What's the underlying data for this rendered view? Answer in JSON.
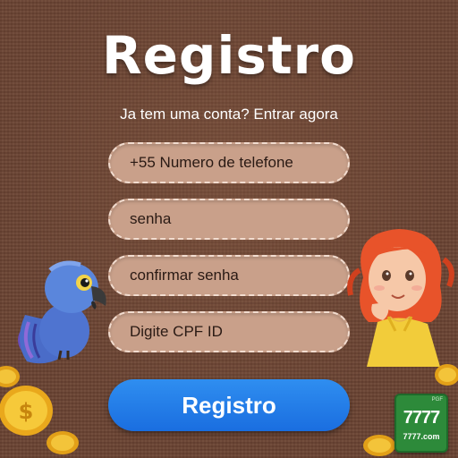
{
  "header": {
    "title": "Registro",
    "subtitle": "Ja tem uma conta? Entrar agora"
  },
  "form": {
    "phone_placeholder": "+55 Numero de telefone",
    "password_placeholder": "senha",
    "confirm_placeholder": "confirmar senha",
    "cpf_placeholder": "Digite CPF ID",
    "submit_label": "Registro"
  },
  "logo": {
    "text": "7777",
    "domain": "7777.com",
    "tag": "PGF"
  },
  "colors": {
    "background": "#6b4433",
    "field_fill": "#c9a08a",
    "button": "#1a6ee0"
  }
}
